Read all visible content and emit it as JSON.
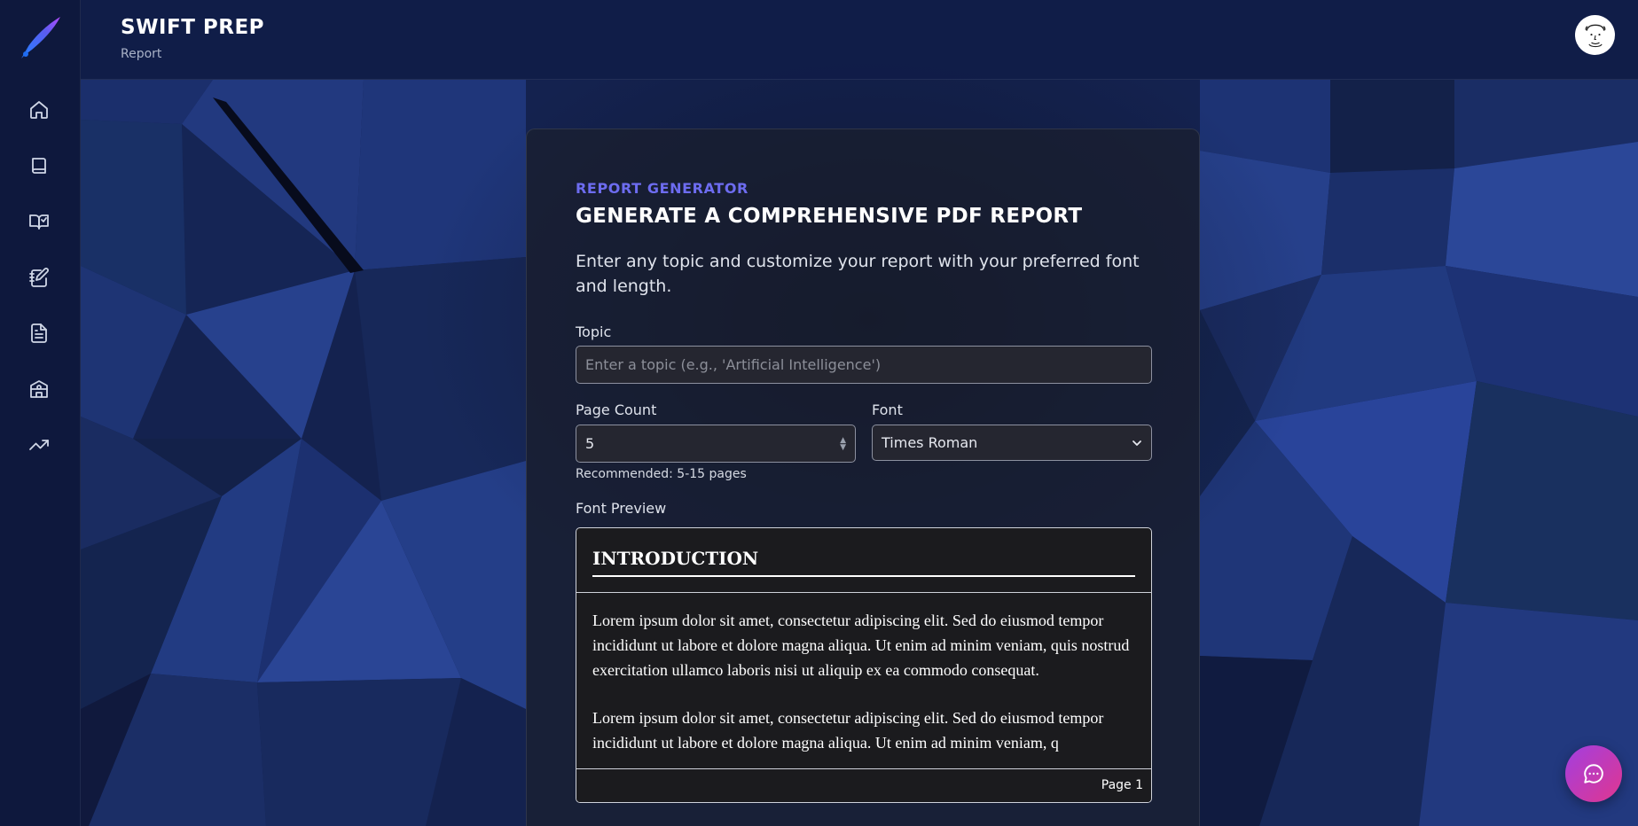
{
  "app": {
    "brand": "SWIFT PREP",
    "breadcrumb": "Report"
  },
  "sidebar": {
    "items": [
      {
        "icon": "home-icon"
      },
      {
        "icon": "book-icon"
      },
      {
        "icon": "book-check-icon"
      },
      {
        "icon": "notebook-pen-icon"
      },
      {
        "icon": "file-text-icon"
      },
      {
        "icon": "school-icon"
      },
      {
        "icon": "trending-up-icon"
      }
    ]
  },
  "form": {
    "eyebrow": "REPORT GENERATOR",
    "title": "GENERATE A COMPREHENSIVE PDF REPORT",
    "description": "Enter any topic and customize your report with your preferred font and length.",
    "topic_label": "Topic",
    "topic_value": "",
    "topic_placeholder": "Enter a topic (e.g., 'Artificial Intelligence')",
    "page_count_label": "Page Count",
    "page_count_value": "5",
    "page_count_hint": "Recommended: 5-15 pages",
    "font_label": "Font",
    "font_value": "Times Roman"
  },
  "preview": {
    "label": "Font Preview",
    "heading": "INTRODUCTION",
    "paragraph_1": "Lorem ipsum dolor sit amet, consectetur adipiscing elit. Sed do eiusmod tempor incididunt ut labore et dolore magna aliqua. Ut enim ad minim veniam, quis nostrud exercitation ullamco laboris nisi ut aliquip ex ea commodo consequat.",
    "paragraph_2": "Lorem ipsum dolor sit amet, consectetur adipiscing elit. Sed do eiusmod tempor incididunt ut labore et dolore magna aliqua. Ut enim ad minim veniam, q",
    "page_label": "Page 1"
  },
  "colors": {
    "accent": "#6d6cf0",
    "chat_fab_start": "#a23fe0",
    "chat_fab_end": "#e0368f"
  }
}
